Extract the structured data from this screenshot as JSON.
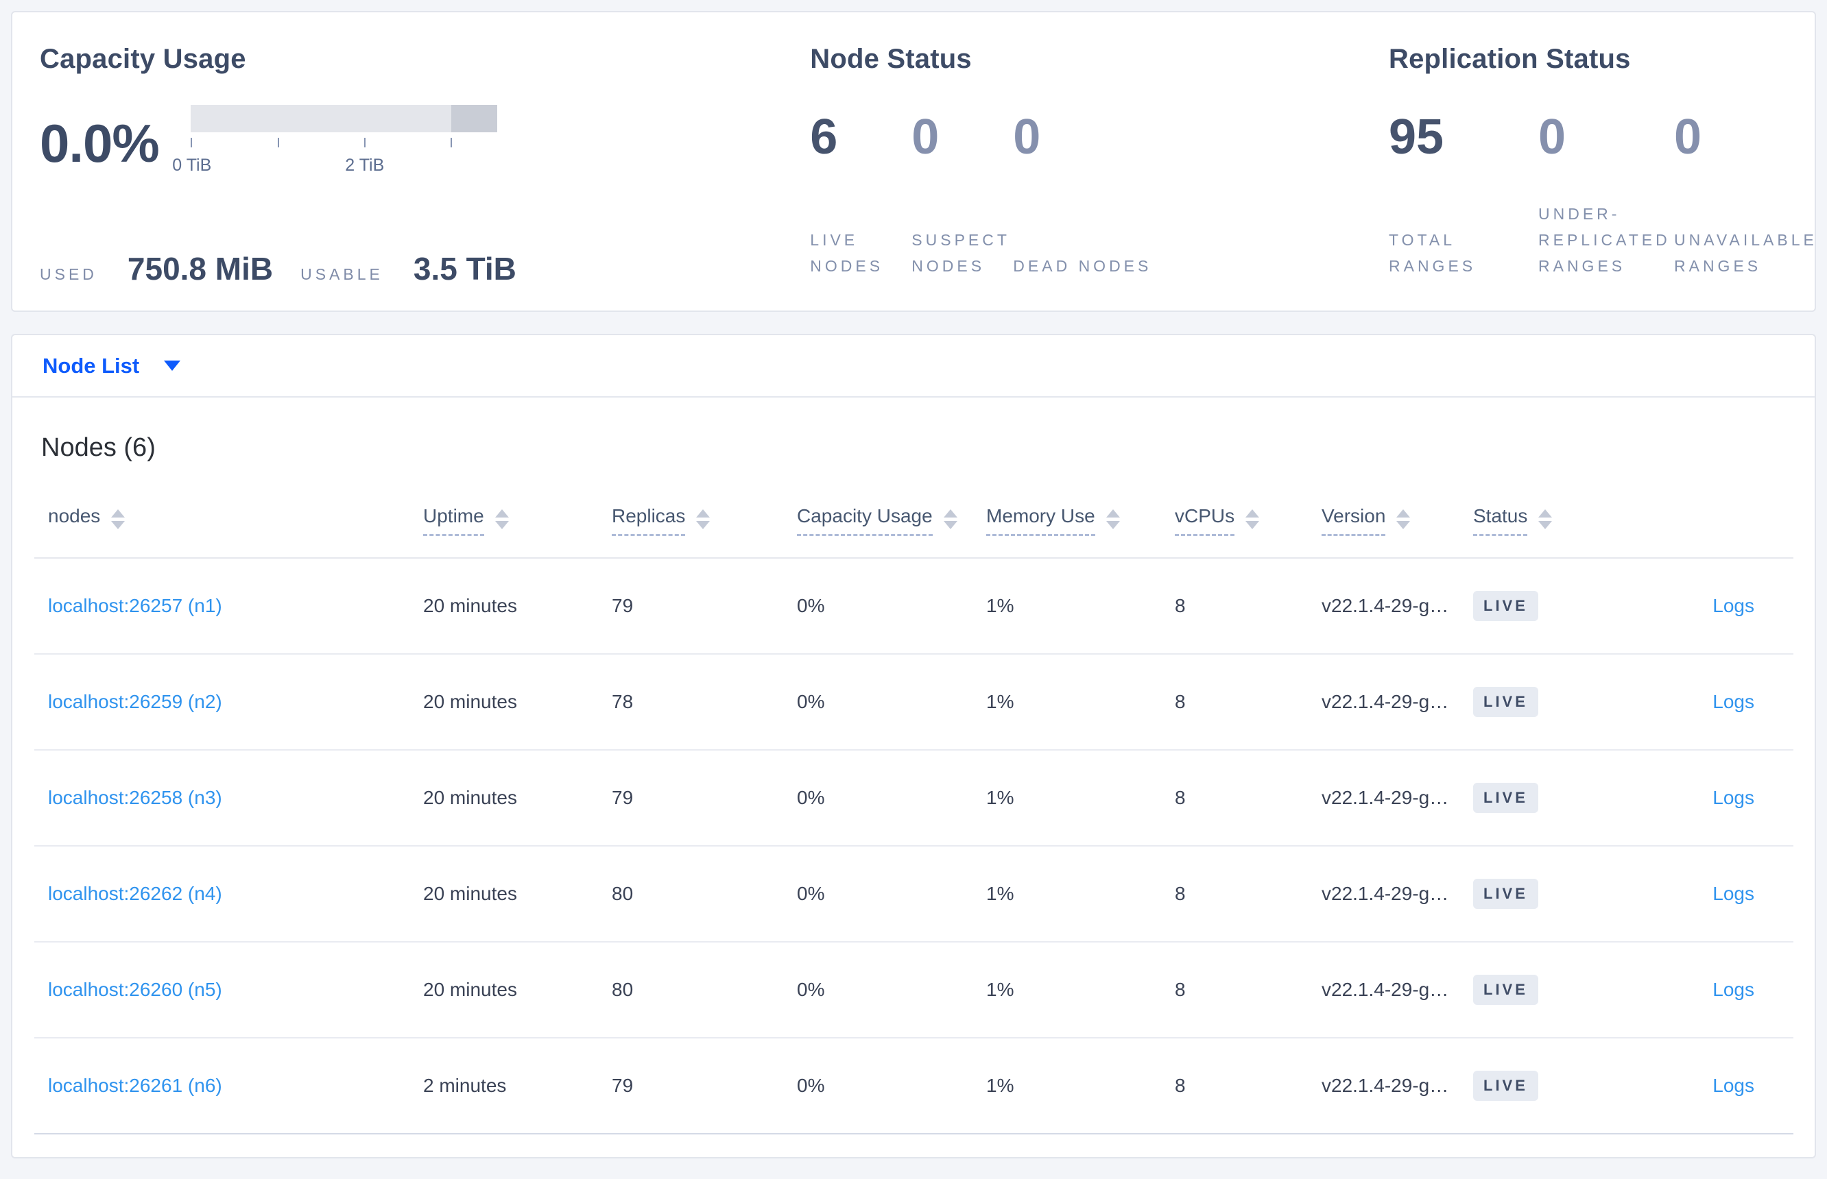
{
  "colors": {
    "page_background": "#f3f5f9",
    "link_primary": "#0e5bfc",
    "link_secondary": "#2f93ee",
    "bar_light": "#e4e6eb",
    "bar_dark": "#c9cdd6",
    "badge_background": "#e7ebf2",
    "badge_text": "#3f4c66",
    "stat_emphasis": "#46536d",
    "stat_dim": "#8590ad"
  },
  "summary": {
    "capacity": {
      "title": "Capacity Usage",
      "percent": "0.0%",
      "tick_label_0": "0 TiB",
      "tick_label_2": "2 TiB",
      "used_label": "USED",
      "used_value": "750.8 MiB",
      "usable_label": "USABLE",
      "usable_value": "3.5 TiB"
    },
    "node_status": {
      "title": "Node Status",
      "stats": [
        {
          "value": "6",
          "label": "LIVE NODES"
        },
        {
          "value": "0",
          "label": "SUSPECT NODES"
        },
        {
          "value": "0",
          "label": "DEAD NODES"
        }
      ]
    },
    "replication": {
      "title": "Replication Status",
      "stats": [
        {
          "value": "95",
          "label": "TOTAL RANGES"
        },
        {
          "value": "0",
          "label": "UNDER-REPLICATED RANGES"
        },
        {
          "value": "0",
          "label": "UNAVAILABLE RANGES"
        }
      ]
    }
  },
  "node_list": {
    "selector_label": "Node List"
  },
  "table": {
    "title": "Nodes (6)",
    "columns": [
      "nodes",
      "Uptime",
      "Replicas",
      "Capacity Usage",
      "Memory Use",
      "vCPUs",
      "Version",
      "Status"
    ],
    "logs_label": "Logs",
    "rows": [
      {
        "node": "localhost:26257 (n1)",
        "uptime": "20 minutes",
        "replicas": "79",
        "capacity": "0%",
        "memory": "1%",
        "vcpus": "8",
        "version": "v22.1.4-29-g…",
        "status": "LIVE"
      },
      {
        "node": "localhost:26259 (n2)",
        "uptime": "20 minutes",
        "replicas": "78",
        "capacity": "0%",
        "memory": "1%",
        "vcpus": "8",
        "version": "v22.1.4-29-g…",
        "status": "LIVE"
      },
      {
        "node": "localhost:26258 (n3)",
        "uptime": "20 minutes",
        "replicas": "79",
        "capacity": "0%",
        "memory": "1%",
        "vcpus": "8",
        "version": "v22.1.4-29-g…",
        "status": "LIVE"
      },
      {
        "node": "localhost:26262 (n4)",
        "uptime": "20 minutes",
        "replicas": "80",
        "capacity": "0%",
        "memory": "1%",
        "vcpus": "8",
        "version": "v22.1.4-29-g…",
        "status": "LIVE"
      },
      {
        "node": "localhost:26260 (n5)",
        "uptime": "20 minutes",
        "replicas": "80",
        "capacity": "0%",
        "memory": "1%",
        "vcpus": "8",
        "version": "v22.1.4-29-g…",
        "status": "LIVE"
      },
      {
        "node": "localhost:26261 (n6)",
        "uptime": "2 minutes",
        "replicas": "79",
        "capacity": "0%",
        "memory": "1%",
        "vcpus": "8",
        "version": "v22.1.4-29-g…",
        "status": "LIVE"
      }
    ]
  }
}
